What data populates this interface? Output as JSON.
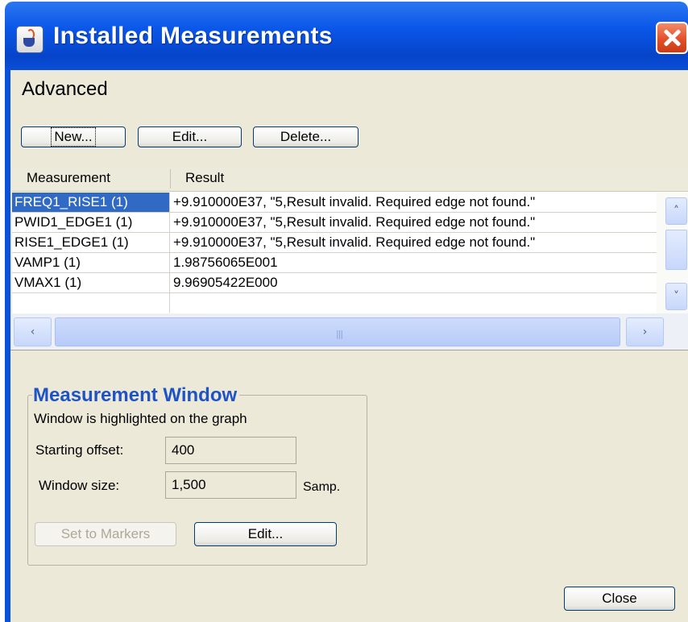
{
  "window": {
    "title": "Installed Measurements"
  },
  "section_title": "Advanced",
  "toolbar": {
    "new_label": "New...",
    "edit_label": "Edit...",
    "delete_label": "Delete..."
  },
  "table": {
    "columns": [
      "Measurement",
      "Result"
    ],
    "rows": [
      {
        "measurement": "FREQ1_RISE1 (1)",
        "result": "+9.910000E37, \"5,Result invalid. Required edge not found.\"",
        "selected": true
      },
      {
        "measurement": "PWID1_EDGE1 (1)",
        "result": "+9.910000E37, \"5,Result invalid. Required edge not found.\"",
        "selected": false
      },
      {
        "measurement": "RISE1_EDGE1 (1)",
        "result": "+9.910000E37, \"5,Result invalid. Required edge not found.\"",
        "selected": false
      },
      {
        "measurement": "VAMP1 (1)",
        "result": "1.98756065E001",
        "selected": false
      },
      {
        "measurement": "VMAX1 (1)",
        "result": "9.96905422E000",
        "selected": false
      }
    ]
  },
  "measurement_window": {
    "title": "Measurement Window",
    "hint": "Window is highlighted on the graph",
    "starting_offset_label": "Starting offset:",
    "starting_offset_value": "400",
    "window_size_label": "Window size:",
    "window_size_value": "1,500",
    "window_size_unit": "Samp.",
    "set_to_markers_label": "Set to Markers",
    "edit_label": "Edit..."
  },
  "footer": {
    "close_label": "Close"
  },
  "colors": {
    "title_bar": "#0a56e8",
    "selection": "#316ac5",
    "group_title": "#1e53c6"
  }
}
